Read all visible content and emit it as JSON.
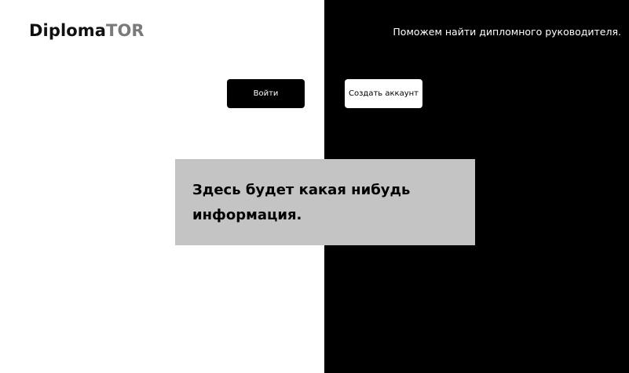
{
  "header": {
    "logo_main": "Diploma",
    "logo_accent": "TOR",
    "tagline": "Поможем найти дипломного руководителя."
  },
  "actions": {
    "login_label": "Войти",
    "signup_label": "Создать аккаунт"
  },
  "info": {
    "text": "Здесь будет какая нибудь информация."
  },
  "colors": {
    "left_background": "#ffffff",
    "right_background": "#000000",
    "logo_accent": "#7a7a7a",
    "info_box": "#c4c4c4"
  }
}
